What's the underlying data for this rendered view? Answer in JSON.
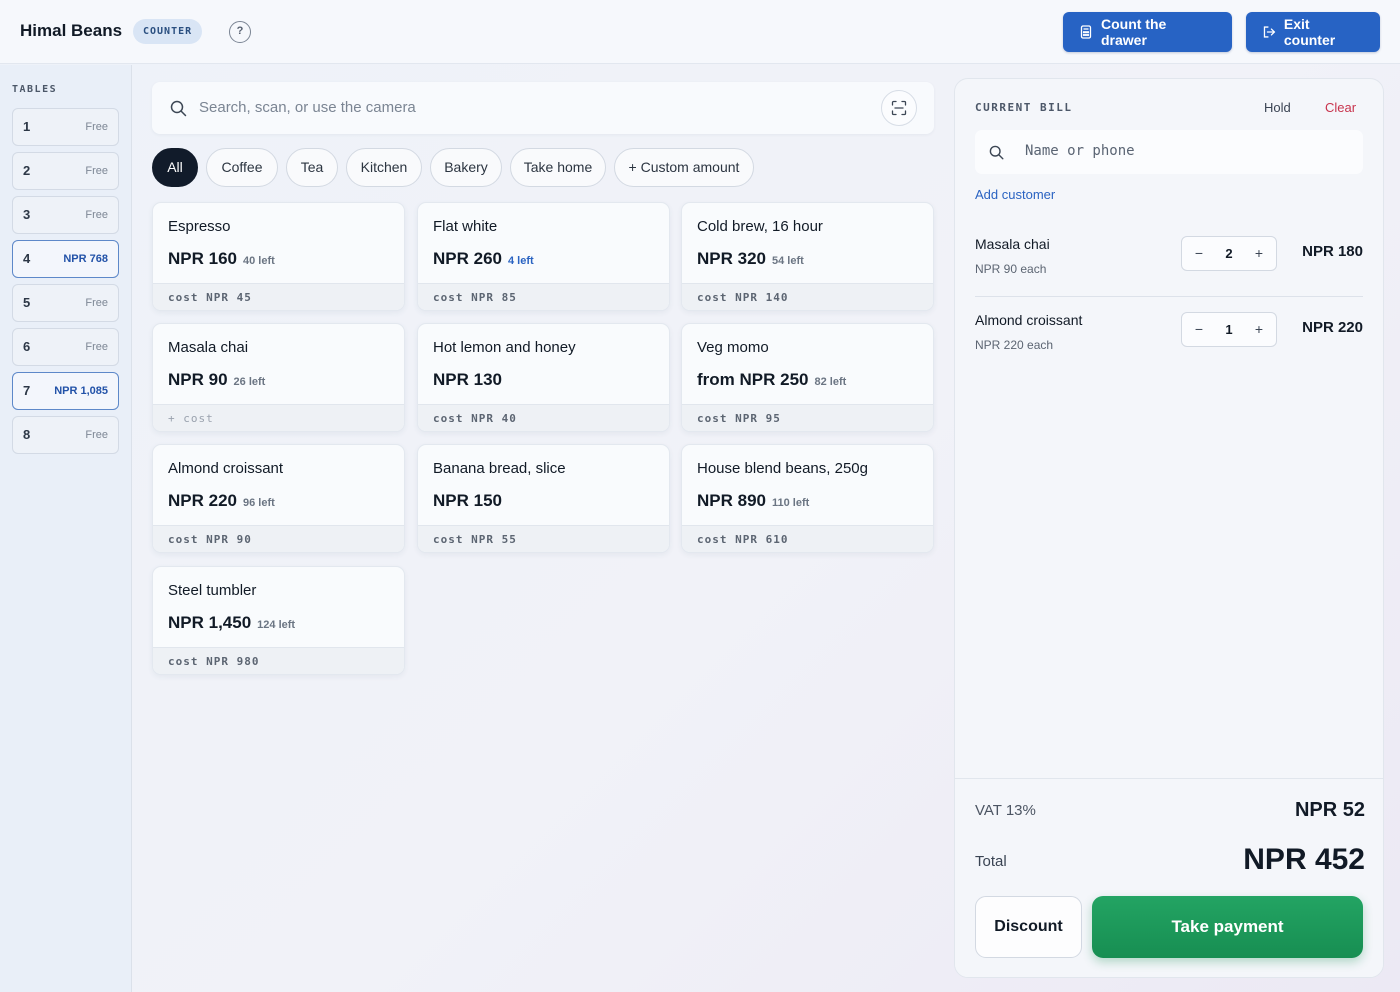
{
  "header": {
    "brand": "Himal Beans",
    "badge": "COUNTER",
    "help": "?",
    "count_drawer": "Count the drawer",
    "exit_counter": "Exit counter",
    "accent": "#2763c4"
  },
  "sidebar": {
    "title": "TABLES",
    "tables": [
      {
        "num": "1",
        "status": "Free"
      },
      {
        "num": "2",
        "status": "Free"
      },
      {
        "num": "3",
        "status": "Free"
      },
      {
        "num": "4",
        "status": "NPR 768"
      },
      {
        "num": "5",
        "status": "Free"
      },
      {
        "num": "6",
        "status": "Free"
      },
      {
        "num": "7",
        "status": "NPR 1,085"
      },
      {
        "num": "8",
        "status": "Free"
      }
    ]
  },
  "search": {
    "placeholder": "Search, scan, or use the camera"
  },
  "filters": [
    "All",
    "Coffee",
    "Tea",
    "Kitchen",
    "Bakery",
    "Take home",
    "+ Custom amount"
  ],
  "products": [
    {
      "name": "Espresso",
      "price": "NPR 160",
      "left": "40 left",
      "cost": "cost NPR 45"
    },
    {
      "name": "Flat white",
      "price": "NPR 260",
      "left": "4 left",
      "cost": "cost NPR 85"
    },
    {
      "name": "Cold brew, 16 hour",
      "price": "NPR 320",
      "left": "54 left",
      "cost": "cost NPR 140"
    },
    {
      "name": "Masala chai",
      "price": "NPR 90",
      "left": "26 left",
      "cost": "+ cost"
    },
    {
      "name": "Hot lemon and honey",
      "price": "NPR 130",
      "left": "",
      "cost": "cost NPR 40"
    },
    {
      "name": "Veg momo",
      "price": "from NPR 250",
      "left": "82 left",
      "cost": "cost NPR 95"
    },
    {
      "name": "Almond croissant",
      "price": "NPR 220",
      "left": "96 left",
      "cost": "cost NPR 90"
    },
    {
      "name": "Banana bread, slice",
      "price": "NPR 150",
      "left": "",
      "cost": "cost NPR 55"
    },
    {
      "name": "House blend beans, 250g",
      "price": "NPR 890",
      "left": "110 left",
      "cost": "cost NPR 610"
    },
    {
      "name": "Steel tumbler",
      "price": "NPR 1,450",
      "left": "124 left",
      "cost": "cost NPR 980"
    }
  ],
  "bill": {
    "title": "CURRENT BILL",
    "hold": "Hold",
    "clear": "Clear",
    "customer_placeholder": "Name or phone",
    "add_customer": "Add customer",
    "lines": [
      {
        "name": "Masala chai",
        "each": "NPR 90 each",
        "qty": "2",
        "total": "NPR 180"
      },
      {
        "name": "Almond croissant",
        "each": "NPR 220 each",
        "qty": "1",
        "total": "NPR 220"
      }
    ],
    "vat_label": "VAT 13%",
    "vat_value": "NPR 52",
    "total_label": "Total",
    "total_value": "NPR 452",
    "discount": "Discount",
    "take_payment": "Take payment",
    "pay_color": "#1b9a5a",
    "clear_color": "#c8344d"
  }
}
